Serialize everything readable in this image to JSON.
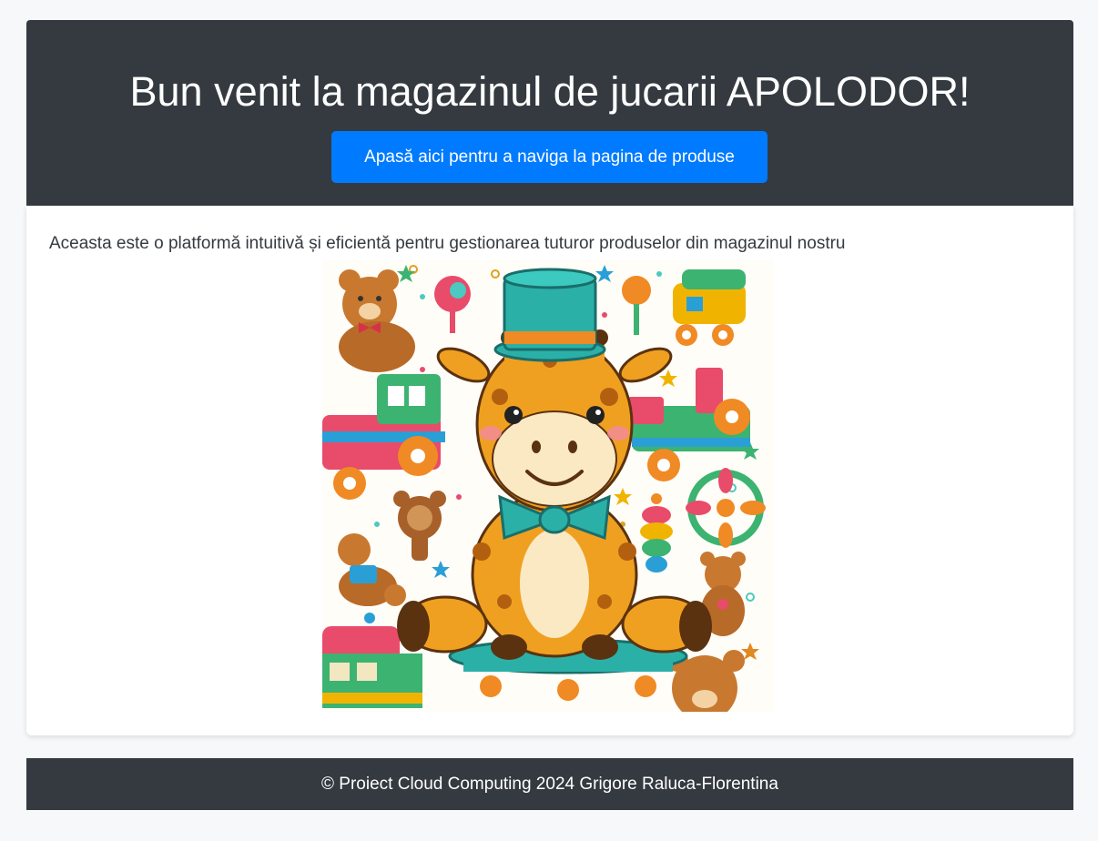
{
  "header": {
    "title": "Bun venit la magazinul de jucarii APOLODOR!",
    "nav_button_label": "Apasă aici pentru a naviga la pagina de produse"
  },
  "main": {
    "description": "Aceasta este o platformă intuitivă și eficientă pentru gestionarea tuturor produselor din magazinul nostru"
  },
  "footer": {
    "text": "© Proiect Cloud Computing 2024 Grigore Raluca-Florentina"
  },
  "colors": {
    "header_bg": "#343a40",
    "button_bg": "#007bff",
    "page_bg": "#f7f8fa"
  }
}
